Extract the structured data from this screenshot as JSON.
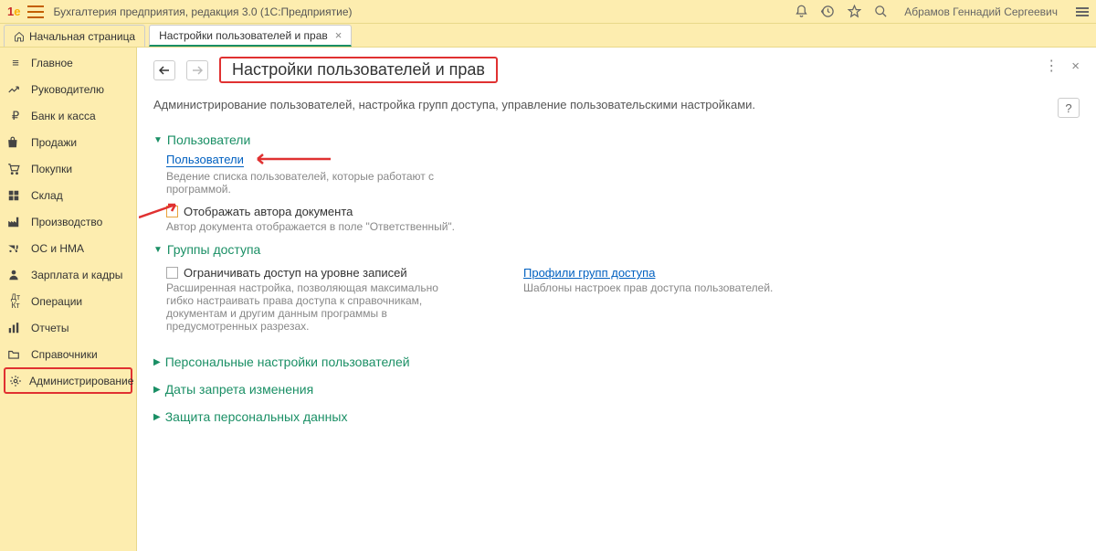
{
  "titlebar": {
    "app_title": "Бухгалтерия предприятия, редакция 3.0  (1С:Предприятие)",
    "user_name": "Абрамов Геннадий Сергеевич"
  },
  "tabs": {
    "home": "Начальная страница",
    "active": "Настройки пользователей и прав"
  },
  "sidebar": {
    "items": [
      {
        "label": "Главное"
      },
      {
        "label": "Руководителю"
      },
      {
        "label": "Банк и касса"
      },
      {
        "label": "Продажи"
      },
      {
        "label": "Покупки"
      },
      {
        "label": "Склад"
      },
      {
        "label": "Производство"
      },
      {
        "label": "ОС и НМА"
      },
      {
        "label": "Зарплата и кадры"
      },
      {
        "label": "Операции"
      },
      {
        "label": "Отчеты"
      },
      {
        "label": "Справочники"
      },
      {
        "label": "Администрирование"
      }
    ]
  },
  "page": {
    "title": "Настройки пользователей и прав",
    "description": "Администрирование пользователей, настройка групп доступа, управление пользовательскими настройками.",
    "help": "?",
    "section_users": "Пользователи",
    "users_link": "Пользователи",
    "users_hint": "Ведение списка пользователей, которые работают с программой.",
    "show_author_label": "Отображать автора документа",
    "show_author_hint": "Автор документа отображается в поле \"Ответственный\".",
    "section_access": "Группы доступа",
    "restrict_label": "Ограничивать доступ на уровне записей",
    "restrict_hint": "Расширенная настройка, позволяющая максимально гибко настраивать права доступа к справочникам, документам и другим данным программы в предусмотренных разрезах.",
    "profiles_link": "Профили групп доступа",
    "profiles_hint": "Шаблоны настроек прав доступа пользователей.",
    "section_personal": "Персональные настройки пользователей",
    "section_dates": "Даты запрета изменения",
    "section_protect": "Защита персональных данных"
  }
}
